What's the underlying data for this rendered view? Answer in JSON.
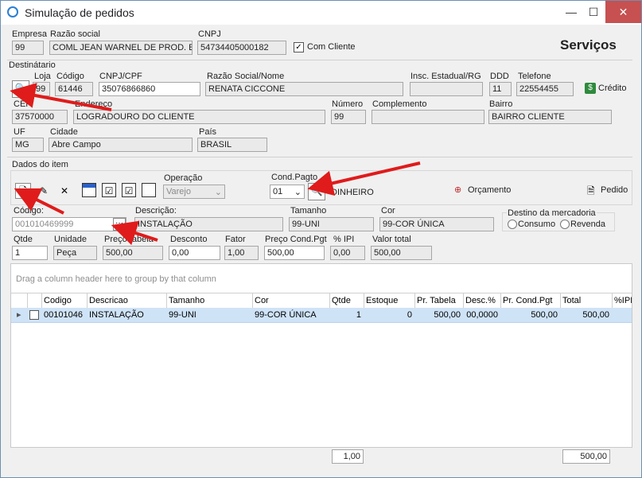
{
  "window": {
    "title": "Simulação de pedidos",
    "minimize": "—",
    "maximize": "☐",
    "close": "✕"
  },
  "header": {
    "empresa_label": "Empresa",
    "empresa_value": "99",
    "razao_label": "Razão social",
    "razao_value": "COML JEAN WARNEL DE PROD. ESP.",
    "cnpj_label": "CNPJ",
    "cnpj_value": "54734405000182",
    "com_cliente_label": "Com Cliente",
    "com_cliente_checked": true,
    "heading": "Serviços"
  },
  "destinatario": {
    "section": "Destinátario",
    "loja_label": "Loja",
    "loja_value": "99",
    "codigo_label": "Código",
    "codigo_value": "61446",
    "cnpjcpf_label": "CNPJ/CPF",
    "cnpjcpf_value": "35076866860",
    "razao_label": "Razão Social/Nome",
    "razao_value": "RENATA CICCONE",
    "insc_label": "Insc. Estadual/RG",
    "insc_value": "",
    "ddd_label": "DDD",
    "ddd_value": "11",
    "telefone_label": "Telefone",
    "telefone_value": "22554455",
    "credito_label": "Crédito",
    "cep_label": "CEP",
    "cep_value": "37570000",
    "endereco_label": "Endereço",
    "endereco_value": "LOGRADOURO DO CLIENTE",
    "numero_label": "Número",
    "numero_value": "99",
    "complemento_label": "Complemento",
    "complemento_value": "",
    "bairro_label": "Bairro",
    "bairro_value": "BAIRRO CLIENTE",
    "uf_label": "UF",
    "uf_value": "MG",
    "cidade_label": "Cidade",
    "cidade_value": "Abre Campo",
    "pais_label": "País",
    "pais_value": "BRASIL"
  },
  "item": {
    "section": "Dados do item",
    "operacao_label": "Operação",
    "operacao_value": "Varejo",
    "condpagto_label": "Cond.Pagto",
    "condpagto_value": "01",
    "condpagto_desc": "DINHEIRO",
    "orcamento_label": "Orçamento",
    "pedido_label": "Pedido",
    "codigo_label": "Código:",
    "codigo_value": "001010469999",
    "ellipsis": "···",
    "descricao_label": "Descrição:",
    "descricao_value": "INSTALAÇÃO",
    "tamanho_label": "Tamanho",
    "tamanho_value": "99-UNI",
    "cor_label": "Cor",
    "cor_value": "99-COR ÚNICA",
    "destino_label": "Destino da mercadoria",
    "consumo_label": "Consumo",
    "revenda_label": "Revenda",
    "qtde_label": "Qtde",
    "qtde_value": "1",
    "unidade_label": "Unidade",
    "unidade_value": "Peça",
    "preco_label": "Preço tabela",
    "preco_value": "500,00",
    "desconto_label": "Desconto",
    "desconto_value": "0,00",
    "fator_label": "Fator",
    "fator_value": "1,00",
    "precocond_label": "Preço Cond.Pgt",
    "precocond_value": "500,00",
    "ipi_label": "% IPI",
    "ipi_value": "0,00",
    "total_label": "Valor total",
    "total_value": "500,00"
  },
  "grid": {
    "hint": "Drag a column header here to group by that column",
    "columns": [
      "Codigo",
      "Descricao",
      "Tamanho",
      "Cor",
      "Qtde",
      "Estoque",
      "Pr. Tabela",
      "Desc.%",
      "Pr. Cond.Pgt",
      "Total",
      "%IPI"
    ],
    "row": [
      "00101046",
      "INSTALAÇÃO",
      "99-UNI",
      "99-COR ÚNICA",
      "1",
      "0",
      "500,00",
      "00,0000",
      "500,00",
      "500,00",
      ""
    ],
    "row_marker": "▸",
    "footer_qtde": "1,00",
    "footer_total": "500,00"
  }
}
